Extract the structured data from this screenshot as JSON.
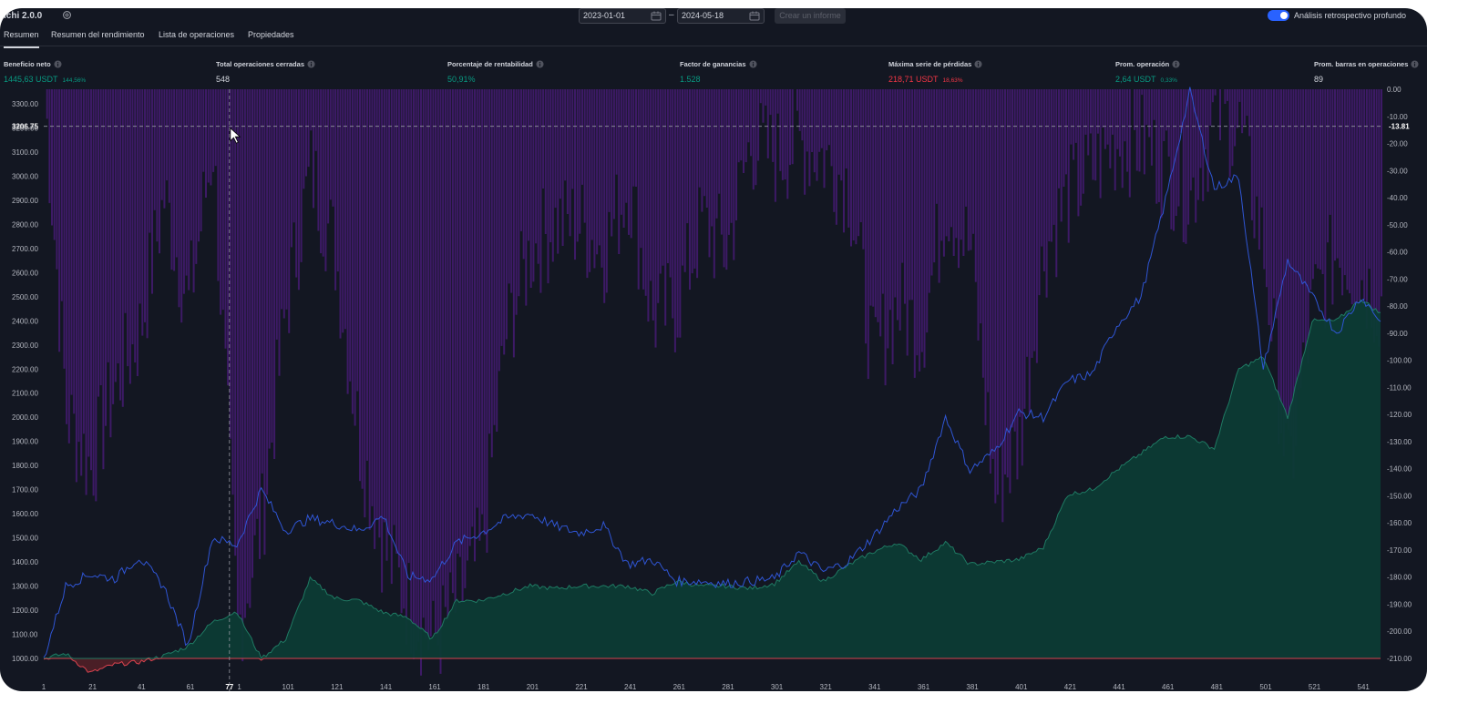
{
  "app": {
    "strategy_name": "ichi 2.0.0",
    "date_from": "2023-01-01",
    "date_to": "2024-05-18",
    "date_separator": "–",
    "report_button": "Crear un informe",
    "deep_backtest_label": "Análisis retrospectivo profundo",
    "deep_backtest_enabled": true
  },
  "tabs": [
    {
      "label": "Resumen",
      "active": true
    },
    {
      "label": "Resumen del rendimiento",
      "active": false
    },
    {
      "label": "Lista de operaciones",
      "active": false
    },
    {
      "label": "Propiedades",
      "active": false
    }
  ],
  "metrics": [
    {
      "label": "Beneficio neto",
      "value": "1445,63 USDT",
      "sub": "144,56%",
      "color": "green"
    },
    {
      "label": "Total operaciones cerradas",
      "value": "548",
      "sub": "",
      "color": "white"
    },
    {
      "label": "Porcentaje de rentabilidad",
      "value": "50,91%",
      "sub": "",
      "color": "green"
    },
    {
      "label": "Factor de ganancias",
      "value": "1.528",
      "sub": "",
      "color": "green"
    },
    {
      "label": "Máxima serie de pérdidas",
      "value": "218,71 USDT",
      "sub": "18,63%",
      "color": "red"
    },
    {
      "label": "Prom. operación",
      "value": "2,64 USDT",
      "sub": "0,33%",
      "color": "green"
    },
    {
      "label": "Prom. barras en operaciones",
      "value": "89",
      "sub": "",
      "color": "white"
    }
  ],
  "chart": {
    "crosshair": {
      "left_value": "3206.75",
      "right_value": "-13.81",
      "x_label": "77"
    },
    "left_axis_ticks": [
      "3300.00",
      "3200.00",
      "3100.00",
      "3000.00",
      "2900.00",
      "2800.00",
      "2700.00",
      "2600.00",
      "2500.00",
      "2400.00",
      "2300.00",
      "2200.00",
      "2100.00",
      "2000.00",
      "1900.00",
      "1800.00",
      "1700.00",
      "1600.00",
      "1500.00",
      "1400.00",
      "1300.00",
      "1200.00",
      "1100.00",
      "1000.00"
    ],
    "right_axis_ticks": [
      "0.00",
      "-10.00",
      "-20.00",
      "-30.00",
      "-40.00",
      "-50.00",
      "-60.00",
      "-70.00",
      "-80.00",
      "-90.00",
      "-100.00",
      "-110.00",
      "-120.00",
      "-130.00",
      "-140.00",
      "-150.00",
      "-160.00",
      "-170.00",
      "-180.00",
      "-190.00",
      "-200.00",
      "-210.00"
    ],
    "x_ticks": [
      "1",
      "21",
      "41",
      "61",
      "1",
      "101",
      "121",
      "141",
      "161",
      "181",
      "201",
      "221",
      "241",
      "261",
      "281",
      "301",
      "321",
      "341",
      "361",
      "381",
      "401",
      "421",
      "441",
      "461",
      "481",
      "501",
      "521",
      "541"
    ],
    "colors": {
      "equity_fill": "#0c3b35",
      "equity_line": "#1f7a63",
      "negative_fill": "#4a1e26",
      "negative_line": "#d9434f",
      "buy_hold_line": "#2f55d4",
      "drawdown_bars": "#3d1a66",
      "crosshair": "#9598a1"
    }
  },
  "chart_data": {
    "type": "area",
    "x_range": [
      1,
      548
    ],
    "ylim_left": [
      1000,
      3300
    ],
    "ylim_right": [
      -210,
      0
    ],
    "series": [
      {
        "values_trade": [
          1,
          10,
          20,
          30,
          40,
          50,
          60,
          70,
          80,
          90,
          100,
          110,
          120,
          130,
          140,
          150,
          160,
          170,
          180,
          190,
          200,
          210,
          220,
          230,
          240,
          250,
          260,
          270,
          280,
          290,
          300,
          310,
          320,
          330,
          340,
          350,
          360,
          370,
          380,
          390,
          400,
          410,
          420,
          430,
          440,
          450,
          460,
          470,
          480,
          490,
          500,
          510,
          520,
          530,
          540,
          548
        ],
        "values": [
          1000,
          1020,
          940,
          975,
          985,
          1010,
          1050,
          1150,
          1195,
          1000,
          1080,
          1330,
          1250,
          1240,
          1190,
          1170,
          1080,
          1240,
          1240,
          1270,
          1300,
          1290,
          1300,
          1300,
          1300,
          1270,
          1320,
          1300,
          1300,
          1290,
          1310,
          1400,
          1320,
          1385,
          1440,
          1480,
          1410,
          1480,
          1390,
          1400,
          1410,
          1460,
          1680,
          1700,
          1780,
          1850,
          1920,
          1920,
          1870,
          2200,
          2250,
          2000,
          2400,
          2400,
          2490,
          2430
        ]
      },
      {
        "values_trade": [
          1,
          10,
          20,
          30,
          40,
          50,
          60,
          70,
          80,
          90,
          100,
          110,
          120,
          130,
          140,
          150,
          160,
          170,
          180,
          190,
          200,
          210,
          220,
          230,
          240,
          250,
          260,
          270,
          280,
          290,
          300,
          310,
          320,
          330,
          340,
          350,
          360,
          370,
          380,
          390,
          400,
          410,
          420,
          430,
          440,
          450,
          460,
          470,
          480,
          490,
          500,
          510,
          520,
          530,
          540,
          548
        ],
        "values": [
          1000,
          1300,
          1350,
          1330,
          1420,
          1300,
          1050,
          1500,
          1470,
          1700,
          1530,
          1580,
          1560,
          1530,
          1590,
          1340,
          1330,
          1480,
          1520,
          1580,
          1600,
          1550,
          1520,
          1550,
          1390,
          1410,
          1320,
          1320,
          1310,
          1320,
          1330,
          1440,
          1360,
          1400,
          1500,
          1620,
          1700,
          2000,
          1780,
          1860,
          2020,
          2000,
          2150,
          2180,
          2380,
          2500,
          2900,
          3350,
          2950,
          3000,
          2200,
          2650,
          2500,
          2350,
          2500,
          2400
        ]
      },
      {
        "values_trade": [
          1,
          10,
          20,
          30,
          40,
          50,
          60,
          70,
          80,
          90,
          100,
          110,
          120,
          130,
          140,
          150,
          160,
          170,
          180,
          190,
          200,
          210,
          220,
          230,
          240,
          250,
          260,
          270,
          280,
          290,
          300,
          310,
          320,
          330,
          340,
          350,
          360,
          370,
          380,
          390,
          400,
          410,
          420,
          430,
          440,
          450,
          460,
          470,
          480,
          490,
          500,
          510,
          520,
          530,
          540,
          548
        ],
        "values": [
          0,
          -120,
          -140,
          -110,
          -90,
          -40,
          -80,
          -20,
          -200,
          -160,
          -80,
          -30,
          -60,
          -130,
          -170,
          -190,
          -205,
          -190,
          -170,
          -90,
          -60,
          -50,
          -50,
          -60,
          -35,
          -85,
          -80,
          -50,
          -60,
          -20,
          -25,
          -20,
          -25,
          -35,
          -100,
          -80,
          -90,
          -40,
          -60,
          -150,
          -130,
          -60,
          -40,
          -30,
          -20,
          -20,
          -30,
          -40,
          -10,
          -15,
          -60,
          -145,
          -80,
          -60,
          -70,
          -80
        ]
      }
    ],
    "xlabel": "",
    "ylabel": ""
  }
}
